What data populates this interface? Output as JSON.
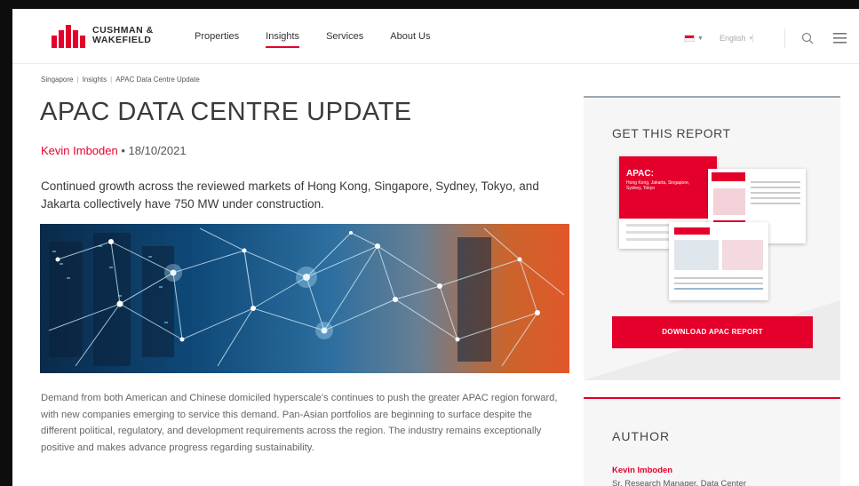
{
  "brand": {
    "line1": "CUSHMAN &",
    "line2": "WAKEFIELD",
    "accent": "#e4002b"
  },
  "nav": [
    {
      "label": "Properties",
      "active": false
    },
    {
      "label": "Insights",
      "active": true
    },
    {
      "label": "Services",
      "active": false
    },
    {
      "label": "About Us",
      "active": false
    }
  ],
  "utility": {
    "language": "English",
    "icons": [
      "flag-icon",
      "search-icon",
      "menu-icon"
    ]
  },
  "breadcrumb": [
    "Singapore",
    "Insights",
    "APAC Data Centre Update"
  ],
  "article": {
    "title": "APAC DATA CENTRE UPDATE",
    "author": "Kevin Imboden",
    "date": "18/10/2021",
    "lead": "Continued growth across the reviewed markets of Hong Kong, Singapore, Sydney, Tokyo, and Jakarta collectively have 750 MW under construction.",
    "body": "Demand from both American and Chinese domiciled hyperscale's continues to push the greater APAC region forward, with new companies emerging to service this demand. Pan-Asian portfolios are beginning to surface despite the different political, regulatory, and development requirements across the region. The industry remains exceptionally positive and makes advance progress regarding sustainability."
  },
  "report": {
    "heading": "GET THIS REPORT",
    "cover_title": "APAC:",
    "cover_subtitle": "Hong Kong, Jakarta, Singapore, Sydney, Tokyo",
    "button_label": "DOWNLOAD APAC REPORT"
  },
  "author_card": {
    "heading": "AUTHOR",
    "name": "Kevin Imboden",
    "role": "Sr. Research Manager, Data Center"
  }
}
